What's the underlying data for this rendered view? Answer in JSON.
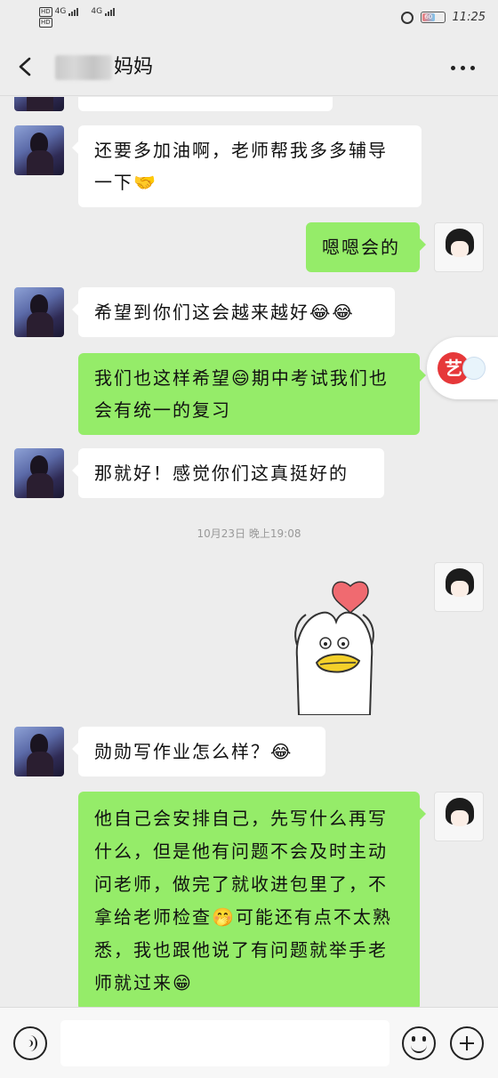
{
  "status_bar": {
    "sim1": "HD",
    "sim2": "HD",
    "network": "4G",
    "battery": "60",
    "time": "11:25"
  },
  "header": {
    "title": "妈妈"
  },
  "messages": [
    {
      "side": "in",
      "text": "还要多加油啊，老师帮我多多辅导一下🤝"
    },
    {
      "side": "out",
      "text": "嗯嗯会的"
    },
    {
      "side": "in",
      "text": "希望到你们这会越来越好😂😂"
    },
    {
      "side": "out",
      "text": "我们也这样希望😄期中考试我们也会有统一的复习"
    },
    {
      "side": "in",
      "text": "那就好！感觉你们这真挺好的"
    },
    {
      "side": "out",
      "text": "他自己会安排自己，先写什么再写什么，但是他有问题不会及时主动问老师，做完了就收进包里了，不拿给老师检查🤭可能还有点不太熟悉，我也跟他说了有问题就举手老师就过来😁"
    }
  ],
  "timestamp": "10月23日 晚上19:08",
  "incoming_after_sticker": "勋勋写作业怎么样？😂",
  "float_app": {
    "logo_char": "艺"
  },
  "icons": {
    "back": "chevron-left-icon",
    "more": "more-dots-icon",
    "voice": "voice-icon",
    "emoji": "emoji-icon",
    "plus": "plus-icon"
  }
}
